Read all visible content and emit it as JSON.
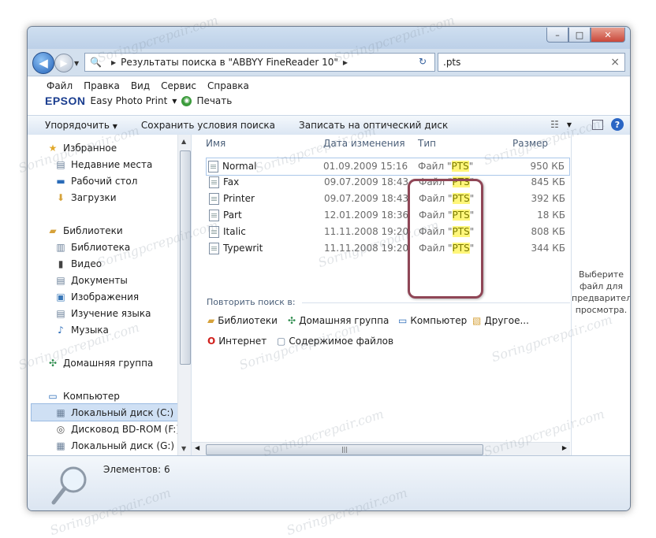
{
  "window": {
    "controls": {
      "minimize": "–",
      "maximize": "□",
      "close": "✕"
    }
  },
  "nav": {
    "back_glyph": "◀",
    "forward_glyph": "▶",
    "address": "Результаты поиска в \"ABBYY FineReader 10\"",
    "search_value": ".pts",
    "search_clear": "×"
  },
  "menu": {
    "items": [
      "Файл",
      "Правка",
      "Вид",
      "Сервис",
      "Справка"
    ]
  },
  "epson": {
    "brand": "EPSON",
    "app": "Easy Photo Print",
    "print": "Печать"
  },
  "toolbar": {
    "organize": "Упорядочить",
    "save_search": "Сохранить условия поиска",
    "burn": "Записать на оптический диск"
  },
  "sidebar": {
    "favorites": "Избранное",
    "recent": "Недавние места",
    "desktop": "Рабочий стол",
    "downloads": "Загрузки",
    "libraries": "Библиотеки",
    "library_items": [
      "Библиотека",
      "Видео",
      "Документы",
      "Изображения",
      "Изучение языка",
      "Музыка"
    ],
    "homegroup": "Домашняя группа",
    "computer": "Компьютер",
    "drives": [
      "Локальный диск (C:)",
      "Дисковод BD-ROM (F:) C",
      "Локальный диск (G:)"
    ]
  },
  "columns": {
    "name": "Имя",
    "date": "Дата изменения",
    "type": "Тип",
    "size": "Размер"
  },
  "files": [
    {
      "name": "Normal",
      "date": "01.09.2009 15:16",
      "type_prefix": "Файл \"",
      "type_ext": "PTS",
      "type_suffix": "\"",
      "size": "950 КБ"
    },
    {
      "name": "Fax",
      "date": "09.07.2009 18:43",
      "type_prefix": "Файл \"",
      "type_ext": "PTS",
      "type_suffix": "\"",
      "size": "845 КБ"
    },
    {
      "name": "Printer",
      "date": "09.07.2009 18:43",
      "type_prefix": "Файл \"",
      "type_ext": "PTS",
      "type_suffix": "\"",
      "size": "392 КБ"
    },
    {
      "name": "Part",
      "date": "12.01.2009 18:36",
      "type_prefix": "Файл \"",
      "type_ext": "PTS",
      "type_suffix": "\"",
      "size": "18 КБ"
    },
    {
      "name": "Italic",
      "date": "11.11.2008 19:20",
      "type_prefix": "Файл \"",
      "type_ext": "PTS",
      "type_suffix": "\"",
      "size": "808 КБ"
    },
    {
      "name": "Typewrit",
      "date": "11.11.2008 19:20",
      "type_prefix": "Файл \"",
      "type_ext": "PTS",
      "type_suffix": "\"",
      "size": "344 КБ"
    }
  ],
  "retry": {
    "label": "Повторить поиск в:",
    "libraries": "Библиотеки",
    "homegroup": "Домашняя группа",
    "computer": "Компьютер",
    "other": "Другое...",
    "internet": "Интернет",
    "contents": "Содержимое файлов"
  },
  "preview": {
    "text": "Выберите файл для предварительного просмотра."
  },
  "status": {
    "items_count": "Элементов: 6"
  },
  "watermark": "Soringpcrepair.com"
}
